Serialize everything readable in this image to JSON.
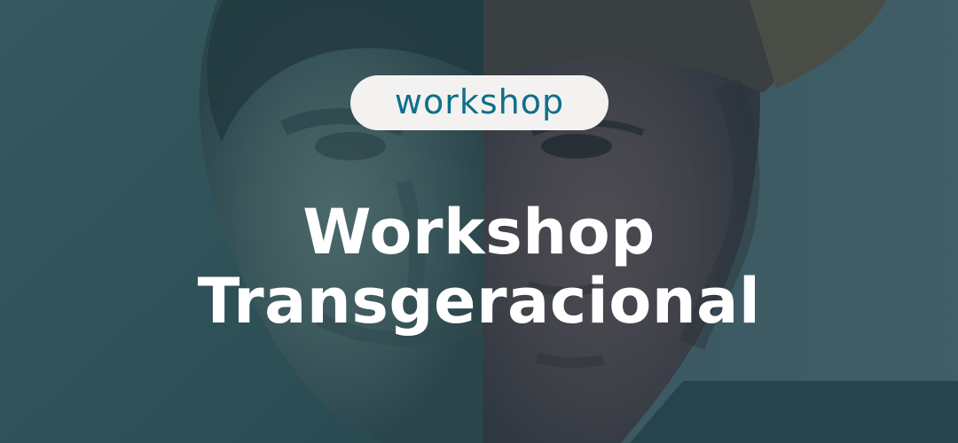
{
  "banner": {
    "badge_label": "workshop",
    "title_line_1": "Workshop",
    "title_line_2": "Transgeracional"
  },
  "colors": {
    "overlay": "#22424C",
    "badge_background": "#F4F2F0",
    "badge_text": "#0F6F8A",
    "title_text": "#FFFFFF"
  }
}
